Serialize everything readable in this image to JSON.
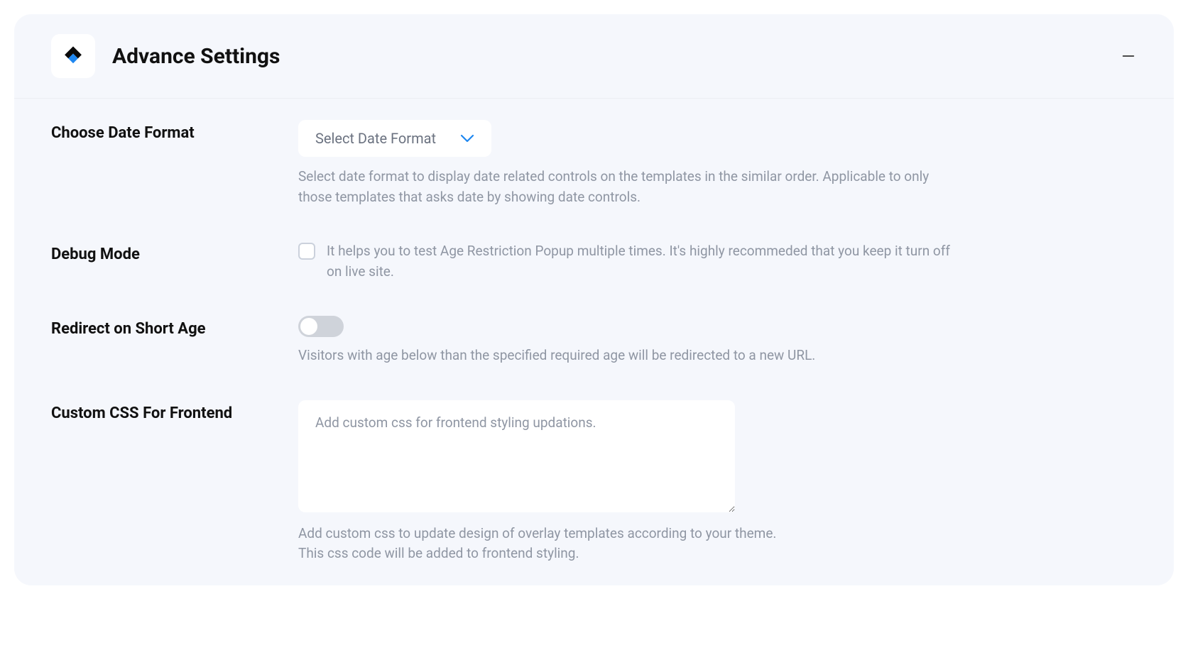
{
  "header": {
    "title": "Advance Settings"
  },
  "dateFormat": {
    "label": "Choose Date Format",
    "selectPlaceholder": "Select Date Format",
    "help": "Select date format to display date related controls on the templates in the similar order. Applicable to only those templates that asks date by showing date controls."
  },
  "debugMode": {
    "label": "Debug Mode",
    "description": "It helps you to test Age Restriction Popup multiple times. It's highly recommeded that you keep it turn off on live site."
  },
  "redirect": {
    "label": "Redirect on Short Age",
    "help": "Visitors with age below than the specified required age will be redirected to a new URL."
  },
  "customCss": {
    "label": "Custom CSS For Frontend",
    "placeholder": "Add custom css for frontend styling updations.",
    "value": "",
    "helpLine1": "Add custom css to update design of overlay templates according to your theme.",
    "helpLine2": "This css code will be added to frontend styling."
  }
}
